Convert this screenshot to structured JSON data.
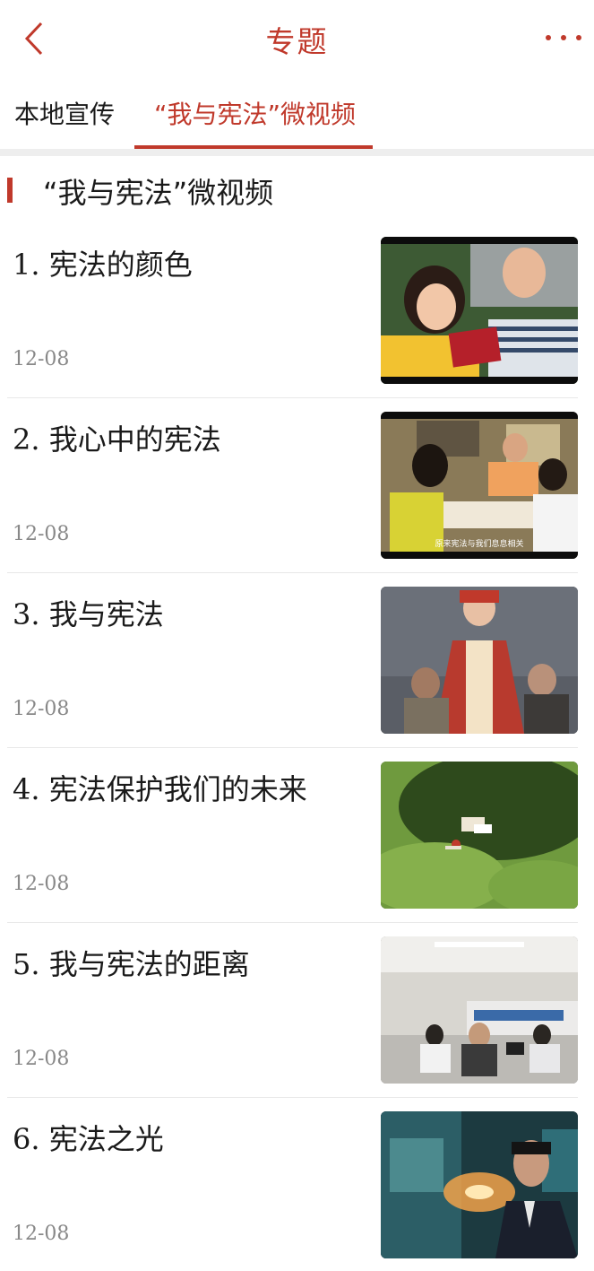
{
  "header": {
    "title": "专题",
    "back_icon": "chevron-left-icon",
    "more_icon": "more-horizontal-icon",
    "accent_color": "#c0392b"
  },
  "tabs": [
    {
      "label": "本地宣传",
      "active": false
    },
    {
      "label": "“我与宪法”微视频",
      "active": true
    }
  ],
  "section": {
    "title": "“我与宪法”微视频"
  },
  "items": [
    {
      "title": "1. 宪法的颜色",
      "date": "12-08"
    },
    {
      "title": "2. 我心中的宪法",
      "date": "12-08",
      "caption": "原来宪法与我们息息相关"
    },
    {
      "title": "3. 我与宪法",
      "date": "12-08"
    },
    {
      "title": "4. 宪法保护我们的未来",
      "date": "12-08"
    },
    {
      "title": "5. 我与宪法的距离",
      "date": "12-08"
    },
    {
      "title": "6. 宪法之光",
      "date": "12-08"
    }
  ]
}
